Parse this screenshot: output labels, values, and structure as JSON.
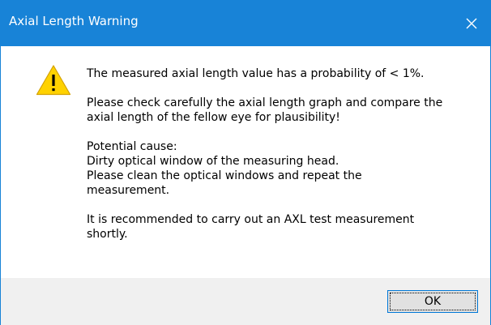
{
  "window": {
    "title": "Axial Length Warning",
    "close_icon": "close-icon",
    "titlebar_color": "#1883d7"
  },
  "dialog": {
    "icon": "warning-icon",
    "messages": [
      "The measured axial length value has a probability of < 1%.",
      "Please check carefully the axial length graph and compare the\naxial length of the fellow eye for plausibility!",
      "Potential cause:\nDirty optical window of the measuring head.\nPlease clean the optical windows and repeat the\nmeasurement.",
      "It is recommended to carry out an AXL test measurement\nshortly."
    ]
  },
  "footer": {
    "ok_label": "OK"
  }
}
